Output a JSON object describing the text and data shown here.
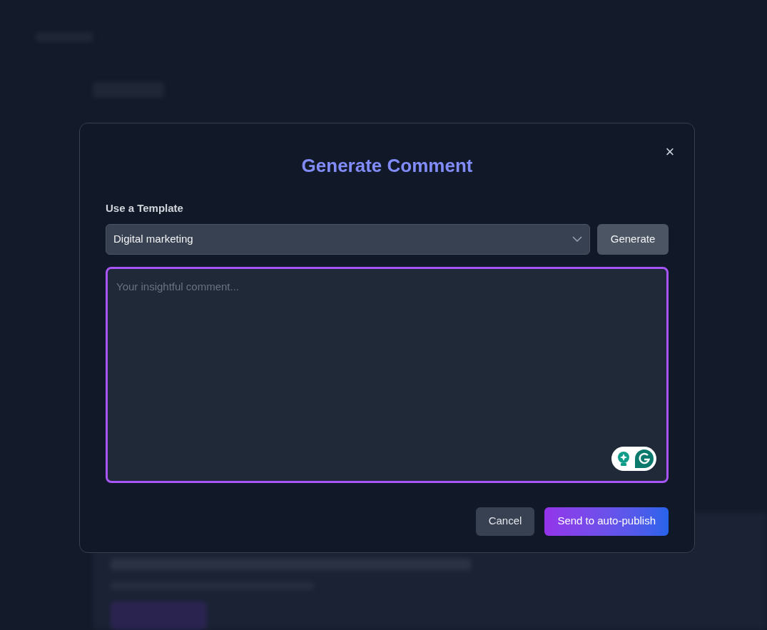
{
  "dialog": {
    "title": "Generate Comment",
    "close_icon": "×",
    "template": {
      "label": "Use a Template",
      "value": "Digital marketing",
      "button": "Generate"
    },
    "comment": {
      "placeholder": "Your insightful comment...",
      "focused": true
    },
    "buttons": [
      {
        "label": "Cancel",
        "kind": "secondary"
      },
      {
        "label": "Send to auto-publish",
        "kind": "primary"
      }
    ]
  }
}
